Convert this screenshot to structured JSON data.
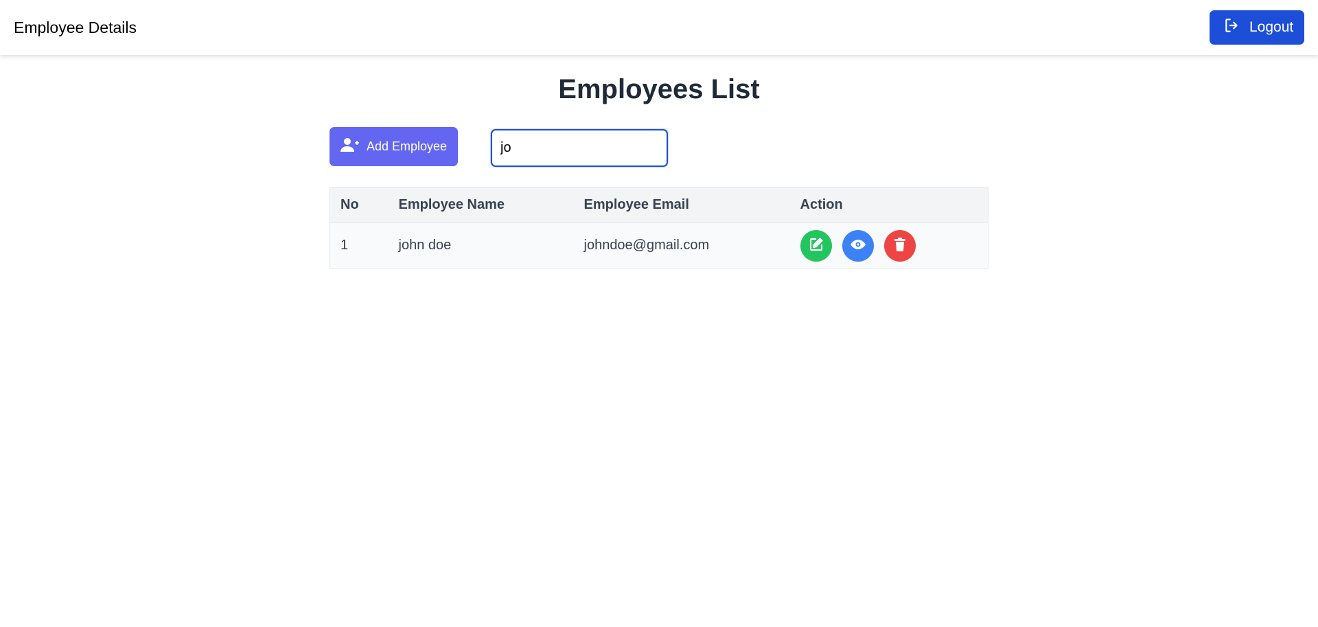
{
  "navbar": {
    "brand": "Employee Details",
    "logout_label": "Logout",
    "logout_icon": "logout-icon"
  },
  "main": {
    "title": "Employees List",
    "add_button_label": "Add Employee",
    "add_button_icon": "user-plus-icon",
    "search_value": "jo"
  },
  "table": {
    "headers": [
      "No",
      "Employee Name",
      "Employee Email",
      "Action"
    ],
    "rows": [
      {
        "no": "1",
        "name": "john doe",
        "email": "johndoe@gmail.com"
      }
    ],
    "action_icons": [
      "edit-icon",
      "eye-icon",
      "trash-icon"
    ]
  },
  "colors": {
    "primary": "#1d4ed8",
    "add_button": "#6366f1",
    "edit": "#22c55e",
    "view": "#3b82f6",
    "delete": "#ef4444"
  }
}
